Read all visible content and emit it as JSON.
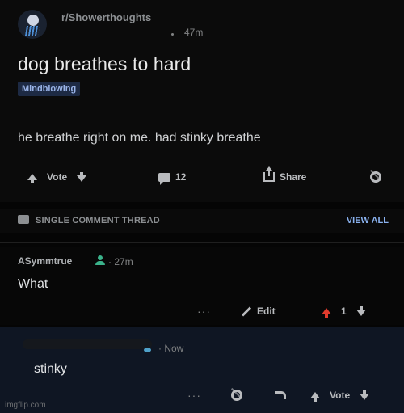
{
  "post": {
    "subreddit": "r/Showerthoughts",
    "time": "47m",
    "title": "dog breathes to hard",
    "flair": "Mindblowing",
    "body": "he breathe right on me. had stinky breathe",
    "vote_label": "Vote",
    "comments_count": "12",
    "share_label": "Share"
  },
  "thread": {
    "label": "SINGLE COMMENT THREAD",
    "view_all": "VIEW ALL"
  },
  "comments": [
    {
      "author": "ASymmtrue",
      "time": "27m",
      "text": "What",
      "more": "···",
      "edit_label": "Edit",
      "score": "1"
    },
    {
      "time": "Now",
      "text": "stinky",
      "more": "···",
      "vote_label": "Vote"
    }
  ],
  "watermark": "imgflip.com",
  "colors": {
    "background": "#050505",
    "flair_bg": "#1d2a44",
    "link_blue": "#8bb3f0",
    "upvote_red": "#e03b2d",
    "mod_green": "#3bb38b",
    "selected_comment_bg": "#0f1623"
  }
}
